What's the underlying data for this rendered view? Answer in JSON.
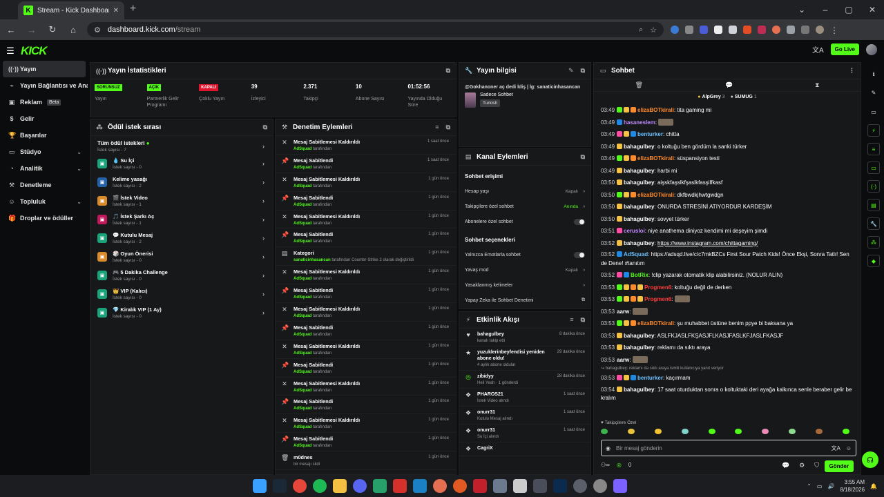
{
  "browser": {
    "tab_title": "Stream - Kick Dashboard",
    "url_domain": "dashboard.kick.com",
    "url_path": "/stream"
  },
  "header": {
    "logo": "KICK",
    "go_live": "Go Live"
  },
  "sidebar": {
    "items": [
      {
        "label": "Yayın"
      },
      {
        "label": "Yayın Bağlantısı ve Anahtarı"
      },
      {
        "label": "Reklam",
        "badge": "Beta"
      },
      {
        "label": "Gelir"
      },
      {
        "label": "Başarılar"
      },
      {
        "label": "Stüdyo"
      },
      {
        "label": "Analitik"
      },
      {
        "label": "Denetleme"
      },
      {
        "label": "Topluluk"
      },
      {
        "label": "Droplar ve ödüller"
      }
    ]
  },
  "stats_panel": {
    "title": "Yayın İstatistikleri",
    "stats": [
      {
        "value": "SORUNSUZ",
        "label": "Yayın",
        "color": "#53fc18"
      },
      {
        "value": "AÇIK",
        "label": "Partnerlik Gelir Programı",
        "color": "#53fc18"
      },
      {
        "value": "KAPALI",
        "label": "Çoklu Yayın",
        "color": "#e0142c"
      },
      {
        "value": "39",
        "label": "İzleyici"
      },
      {
        "value": "2.371",
        "label": "Takipçi"
      },
      {
        "value": "10",
        "label": "Abone Sayısı"
      },
      {
        "value": "01:52:56",
        "label": "Yayında Olduğu Süre"
      }
    ]
  },
  "rewards_panel": {
    "title": "Ödül istek sırası",
    "all_title": "Tüm ödül istekleri",
    "all_sub": "İstek sayısı - 7",
    "items": [
      {
        "title": "💧 Su İçi",
        "sub": "İstek sayısı - 0",
        "color": "#1aa37a"
      },
      {
        "title": "Kelime yasağı",
        "sub": "İstek sayısı - 2",
        "color": "#2563a8"
      },
      {
        "title": "🎬 İstek Video",
        "sub": "İstek sayısı - 1",
        "color": "#d98a2b"
      },
      {
        "title": "🎵 İstek Şarkı Aç",
        "sub": "İstek sayısı - 1",
        "color": "#c2185b"
      },
      {
        "title": "💬 Kutulu Mesaj",
        "sub": "İstek sayısı - 2",
        "color": "#1aa37a"
      },
      {
        "title": "🎲 Oyun Önerisi",
        "sub": "İstek sayısı - 0",
        "color": "#d98a2b"
      },
      {
        "title": "🎮 5 Dakika Challenge",
        "sub": "İstek sayısı - 0",
        "color": "#1aa37a"
      },
      {
        "title": "👑 VIP (Kalıcı)",
        "sub": "İstek sayısı - 0",
        "color": "#1aa37a"
      },
      {
        "title": "💎 Kiralık VIP (1 Ay)",
        "sub": "İstek sayısı - 0",
        "color": "#1aa37a"
      }
    ]
  },
  "mod_panel": {
    "title": "Denetim Eylemleri",
    "items": [
      {
        "icon": "✕",
        "title": "Mesaj Sabitlemesi Kaldırıldı",
        "sub_user": "AdSquad",
        "sub": "tarafından",
        "time": "1 saat önce"
      },
      {
        "icon": "📌",
        "title": "Mesaj Sabitlendi",
        "sub_user": "AdSquad",
        "sub": "tarafından",
        "time": "1 saat önce"
      },
      {
        "icon": "✕",
        "title": "Mesaj Sabitlemesi Kaldırıldı",
        "sub_user": "AdSquad",
        "sub": "tarafından",
        "time": "1 gün önce"
      },
      {
        "icon": "📌",
        "title": "Mesaj Sabitlendi",
        "sub_user": "AdSquad",
        "sub": "tarafından",
        "time": "1 gün önce"
      },
      {
        "icon": "✕",
        "title": "Mesaj Sabitlemesi Kaldırıldı",
        "sub_user": "AdSquad",
        "sub": "tarafından",
        "time": "1 gün önce"
      },
      {
        "icon": "📌",
        "title": "Mesaj Sabitlendi",
        "sub_user": "AdSquad",
        "sub": "tarafından",
        "time": "1 gün önce"
      },
      {
        "icon": "▤",
        "title": "Kategori",
        "sub_user": "sanaticinhasancan",
        "sub": "tarafından Counter-Strike 2 olarak değiştirildi",
        "time": "1 gün önce"
      },
      {
        "icon": "✕",
        "title": "Mesaj Sabitlemesi Kaldırıldı",
        "sub_user": "AdSquad",
        "sub": "tarafından",
        "time": "1 gün önce"
      },
      {
        "icon": "📌",
        "title": "Mesaj Sabitlendi",
        "sub_user": "AdSquad",
        "sub": "tarafından",
        "time": "1 gün önce"
      },
      {
        "icon": "✕",
        "title": "Mesaj Sabitlemesi Kaldırıldı",
        "sub_user": "AdSquad",
        "sub": "tarafından",
        "time": "1 gün önce"
      },
      {
        "icon": "📌",
        "title": "Mesaj Sabitlendi",
        "sub_user": "AdSquad",
        "sub": "tarafından",
        "time": "1 gün önce"
      },
      {
        "icon": "✕",
        "title": "Mesaj Sabitlemesi Kaldırıldı",
        "sub_user": "AdSquad",
        "sub": "tarafından",
        "time": "1 gün önce"
      },
      {
        "icon": "📌",
        "title": "Mesaj Sabitlendi",
        "sub_user": "AdSquad",
        "sub": "tarafından",
        "time": "1 gün önce"
      },
      {
        "icon": "✕",
        "title": "Mesaj Sabitlemesi Kaldırıldı",
        "sub_user": "AdSquad",
        "sub": "tarafından",
        "time": "1 gün önce"
      },
      {
        "icon": "📌",
        "title": "Mesaj Sabitlendi",
        "sub_user": "AdSquad",
        "sub": "tarafından",
        "time": "1 gün önce"
      },
      {
        "icon": "✕",
        "title": "Mesaj Sabitlemesi Kaldırıldı",
        "sub_user": "AdSquad",
        "sub": "tarafından",
        "time": "1 gün önce"
      },
      {
        "icon": "📌",
        "title": "Mesaj Sabitlendi",
        "sub_user": "AdSquad",
        "sub": "tarafından",
        "time": "1 gün önce"
      },
      {
        "icon": "🗑",
        "title": "m0dnes",
        "sub_user": "",
        "sub": "bir mesajı sildi",
        "time": "1 gün önce"
      }
    ]
  },
  "info_panel": {
    "title": "Yayın bilgisi",
    "stream_title": "@Gokhanoner aç dedi İdiş | İg: sanaticinhasancan",
    "category": "Sadece Sohbet",
    "tag": "Turkish"
  },
  "channel_panel": {
    "title": "Kanal Eylemleri",
    "section1": "Sohbet erişimi",
    "rows1": [
      {
        "label": "Hesap yaşı",
        "value": "Kapalı",
        "type": "chev"
      },
      {
        "label": "Takipçilere özel sohbet",
        "value": "Anında",
        "type": "chev",
        "green": true
      },
      {
        "label": "Abonelere özel sohbet",
        "value": "",
        "type": "toggle"
      }
    ],
    "section2": "Sohbet seçenekleri",
    "rows2": [
      {
        "label": "Yalnızca Emotlarla sohbet",
        "value": "",
        "type": "toggle"
      },
      {
        "label": "Yavaş mod",
        "value": "Kapalı",
        "type": "chev"
      },
      {
        "label": "Yasaklanmış kelimeler",
        "value": "",
        "type": "chev"
      },
      {
        "label": "Yapay Zeka ile Sohbet Denetimi",
        "value": "",
        "type": "ext"
      }
    ]
  },
  "activity_panel": {
    "title": "Etkinlik Akışı",
    "items": [
      {
        "icon": "♥",
        "title": "bahagulbey",
        "sub": "kanalı takip etti",
        "time": "8 dakika önce"
      },
      {
        "icon": "★",
        "title": "yuzuklerinbeyfendisi yeniden abone oldu!",
        "sub": "4 aylık abone oldular",
        "time": "29 dakika önce"
      },
      {
        "icon": "◎",
        "title": "zibidyy",
        "sub": "Heil Yeah · 1 gönderdi",
        "time": "28 dakika önce"
      },
      {
        "icon": "❖",
        "title": "PHAROS21",
        "sub": "İstek Video alındı",
        "time": "1 saat önce"
      },
      {
        "icon": "❖",
        "title": "onurr31",
        "sub": "Kutulu Mesaj alındı",
        "time": "1 saat önce"
      },
      {
        "icon": "❖",
        "title": "onurr31",
        "sub": "Su İçi alındı",
        "time": "1 saat önce"
      },
      {
        "icon": "❖",
        "title": "CagriX",
        "sub": "",
        "time": ""
      }
    ]
  },
  "chat": {
    "title": "Sohbet",
    "top_users": [
      {
        "name": "AlpGrey",
        "count": "3"
      },
      {
        "name": "SUMUG",
        "count": "1"
      }
    ],
    "messages": [
      {
        "t": "03:49",
        "u": "elizaBOTkirali",
        "c": "#ff8a2a",
        "m": "tita gaming mi",
        "b": [
          "#53fc18",
          "#f5c242",
          "#ff8a2a"
        ]
      },
      {
        "t": "03:49",
        "u": "hasaneslem",
        "c": "#c18bff",
        "m": "",
        "b": [
          "#1e88e5"
        ],
        "emote": true
      },
      {
        "t": "03:49",
        "u": "benturker",
        "c": "#69c0ff",
        "m": "chitta",
        "b": [
          "#ff4da6",
          "#f5c242",
          "#1e88e5"
        ]
      },
      {
        "t": "03:49",
        "u": "bahagulbey",
        "c": "#fff",
        "m": "o koltuğu ben gördüm la sanki türker",
        "b": [
          "#f5c242"
        ]
      },
      {
        "t": "03:49",
        "u": "elizaBOTkirali",
        "c": "#ff8a2a",
        "m": "süspansiyon testi",
        "b": [
          "#53fc18",
          "#f5c242",
          "#ff8a2a"
        ]
      },
      {
        "t": "03:49",
        "u": "bahagulbey",
        "c": "#fff",
        "m": "harbi mi",
        "b": [
          "#f5c242"
        ]
      },
      {
        "t": "03:50",
        "u": "bahagulbey",
        "c": "#fff",
        "m": "aişskfaşslkfşaslkfasşilfkasf",
        "b": [
          "#f5c242"
        ]
      },
      {
        "t": "03:50",
        "u": "elizaBOTkirali",
        "c": "#ff8a2a",
        "m": "dkfbwdkjhwtgwdgn",
        "b": [
          "#53fc18",
          "#f5c242",
          "#ff8a2a"
        ]
      },
      {
        "t": "03:50",
        "u": "bahagulbey",
        "c": "#fff",
        "m": "ONURDA STRESİNİ ATIYORDUR KARDEŞİM",
        "b": [
          "#f5c242"
        ]
      },
      {
        "t": "03:50",
        "u": "bahagulbey",
        "c": "#fff",
        "m": "sovyet türker",
        "b": [
          "#f5c242"
        ]
      },
      {
        "t": "03:51",
        "u": "cerusloi",
        "c": "#c18bff",
        "m": "niye anathema diniyoz kendimi mi deşeyim şimdi",
        "b": [
          "#ff4da6"
        ]
      },
      {
        "t": "03:52",
        "u": "bahagulbey",
        "c": "#fff",
        "m": "https://www.instagram.com/chittagaming/",
        "b": [
          "#f5c242"
        ],
        "link": true
      },
      {
        "t": "03:52",
        "u": "AdSquad",
        "c": "#69c0ff",
        "m": "https://adsqd.live/c/c7mkBZCs First Sour Patch Kids! Önce Ekşi, Sonra Tatlı! Sen de Dene! #tanıtım",
        "b": [
          "#1e88e5"
        ],
        "wrap": true
      },
      {
        "t": "03:52",
        "u": "BotRix",
        "c": "#53fc18",
        "m": "!clip yazarak otomatik klip alabilirsiniz. (NOLUR ALIN)",
        "b": [
          "#ff4da6",
          "#1e88e5"
        ]
      },
      {
        "t": "03:53",
        "u": "Progmen6",
        "c": "#ff3b3b",
        "m": "koltuğu değil de derken",
        "b": [
          "#53fc18",
          "#f5c242",
          "#ff8a2a",
          "#f5c242"
        ]
      },
      {
        "t": "03:53",
        "u": "Progmen6",
        "c": "#ff3b3b",
        "m": "",
        "b": [
          "#53fc18",
          "#f5c242",
          "#ff8a2a",
          "#f5c242"
        ],
        "emote": true
      },
      {
        "t": "03:53",
        "u": "aarw",
        "c": "#fff",
        "m": "",
        "b": [],
        "emote": true
      },
      {
        "t": "03:53",
        "u": "elizaBOTkirali",
        "c": "#ff8a2a",
        "m": "şu muhabbet üstüne benim ppye bi baksana ya",
        "b": [
          "#53fc18",
          "#f5c242",
          "#ff8a2a"
        ]
      },
      {
        "t": "03:53",
        "u": "bahagulbey",
        "c": "#fff",
        "m": "ASLFKJASLFKŞASJFLKASJFASLKFJASLFKASJF",
        "b": [
          "#f5c242"
        ]
      },
      {
        "t": "03:53",
        "u": "bahagulbey",
        "c": "#fff",
        "m": "reklamı da sıktı araya",
        "b": [
          "#f5c242"
        ]
      },
      {
        "t": "03:53",
        "u": "aarw",
        "c": "#fff",
        "m": "",
        "b": [],
        "emote": true
      },
      {
        "t": "03:53",
        "u": "benturker",
        "c": "#69c0ff",
        "m": "kaçırmam",
        "b": [
          "#ff4da6",
          "#f5c242",
          "#1e88e5"
        ],
        "reply": "↪ bahagulbey: reklamı da sıktı araya ismili kullanıcıya yanıt veriyor"
      },
      {
        "t": "03:54",
        "u": "bahagulbey",
        "c": "#fff",
        "m": "17 saat oturduktan sonra o koltuktaki deri ayağa kalkınca senle beraber gelir be kralım",
        "b": [
          "#f5c242"
        ],
        "wrap": true
      }
    ],
    "followers_only": "Takipçilere Özel",
    "input_placeholder": "Bir mesaj gönderin",
    "points": "0",
    "send": "Gönder"
  },
  "taskbar": {
    "time": "3:55 AM",
    "date": "8/18/2026"
  }
}
